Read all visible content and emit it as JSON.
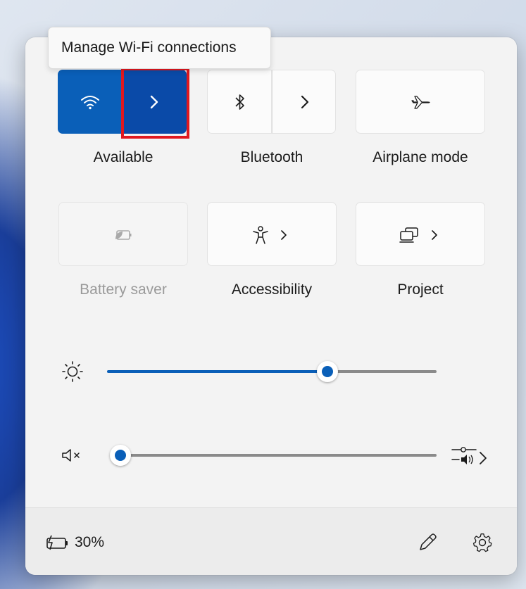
{
  "tooltip": {
    "text": "Manage Wi-Fi connections"
  },
  "tiles": {
    "wifi": {
      "label": "Available",
      "icon": "wifi-icon",
      "chevron": "›"
    },
    "bluetooth": {
      "label": "Bluetooth",
      "icon": "bluetooth-icon"
    },
    "airplane": {
      "label": "Airplane mode",
      "icon": "airplane-icon"
    },
    "battery_saver": {
      "label": "Battery saver",
      "icon": "battery-saver-icon",
      "disabled": true
    },
    "accessibility": {
      "label": "Accessibility",
      "icon": "accessibility-icon"
    },
    "project": {
      "label": "Project",
      "icon": "project-icon"
    }
  },
  "sliders": {
    "brightness": {
      "icon": "brightness-icon",
      "value_fraction": 0.68
    },
    "volume": {
      "icon": "volume-muted-icon",
      "value_fraction": 0.0,
      "output_icon": "audio-output-icon"
    }
  },
  "footer": {
    "battery_text": "30%",
    "battery_icon": "battery-charging-icon",
    "edit_icon": "pencil-icon",
    "settings_icon": "gear-icon"
  },
  "colors": {
    "accent": "#0a5fb8",
    "accent_dark": "#0a4aa8",
    "highlight": "#e0181f"
  }
}
